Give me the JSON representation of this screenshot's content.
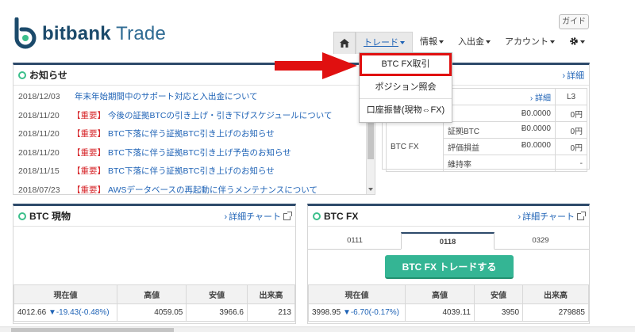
{
  "header": {
    "logo_bold": "bitbank",
    "logo_rest": " Trade",
    "guide_label": "ガイド"
  },
  "nav": {
    "trade": "トレード",
    "info": "情報",
    "deposit": "入出金",
    "account": "アカウント"
  },
  "dropdown": {
    "items": [
      "BTC FX取引",
      "ポジション照会",
      "口座振替(現物⇔FX)"
    ]
  },
  "news": {
    "title": "お知らせ",
    "items": [
      {
        "date": "2018/12/03",
        "important": "",
        "text": "年末年始期間中のサポート対応と入出金について"
      },
      {
        "date": "2018/11/20",
        "important": "【重要】",
        "text": "今後の証拠BTCの引き上げ・引き下げスケジュールについて"
      },
      {
        "date": "2018/11/20",
        "important": "【重要】",
        "text": "BTC下落に伴う証拠BTC引き上げのお知らせ"
      },
      {
        "date": "2018/11/20",
        "important": "【重要】",
        "text": "BTC下落に伴う証拠BTC引き上げ予告のお知らせ"
      },
      {
        "date": "2018/11/15",
        "important": "【重要】",
        "text": "BTC下落に伴う証拠BTC引き上げのお知らせ"
      },
      {
        "date": "2018/07/23",
        "important": "【重要】",
        "text": "AWSデータベースの再起動に伴うメンテナンスについて"
      }
    ]
  },
  "assets": {
    "detail_top": "詳細",
    "detail_row": "詳細",
    "level": "L3",
    "rows": [
      {
        "btc": "Ƀ0.0000",
        "jpy": "0円"
      },
      {
        "btc": "Ƀ0.0000",
        "jpy": "0円"
      },
      {
        "btc": "Ƀ0.0000",
        "jpy": "0円"
      },
      {
        "btc": "Ƀ0.0000",
        "jpy": "0円"
      },
      {
        "btc": "",
        "jpy": "-"
      }
    ],
    "fx_label": "BTC FX",
    "fx_rows": [
      "証拠BTC",
      "評価損益",
      "維持率"
    ]
  },
  "spot": {
    "title": "BTC 現物",
    "chart_link": "詳細チャート",
    "headers": [
      "現在値",
      "高値",
      "安値",
      "出来高"
    ],
    "price": "4012.66",
    "change": "▼-19.43(-0.48%)",
    "high": "4059.05",
    "low": "3966.6",
    "volume": "213"
  },
  "fx": {
    "title": "BTC FX",
    "chart_link": "詳細チャート",
    "tabs": [
      "0111",
      "0118",
      "0329"
    ],
    "trade_button": "BTC FX トレードする",
    "headers": [
      "現在値",
      "高値",
      "安値",
      "出来高"
    ],
    "price": "3998.95",
    "change": "▼-6.70(-0.17%)",
    "high": "4039.11",
    "low": "3950",
    "volume": "279885"
  },
  "colors": {
    "accent": "#2d4a6a",
    "green": "#34b594",
    "link": "#1f63b6",
    "important": "#d7282c",
    "highlight": "#e01010"
  }
}
